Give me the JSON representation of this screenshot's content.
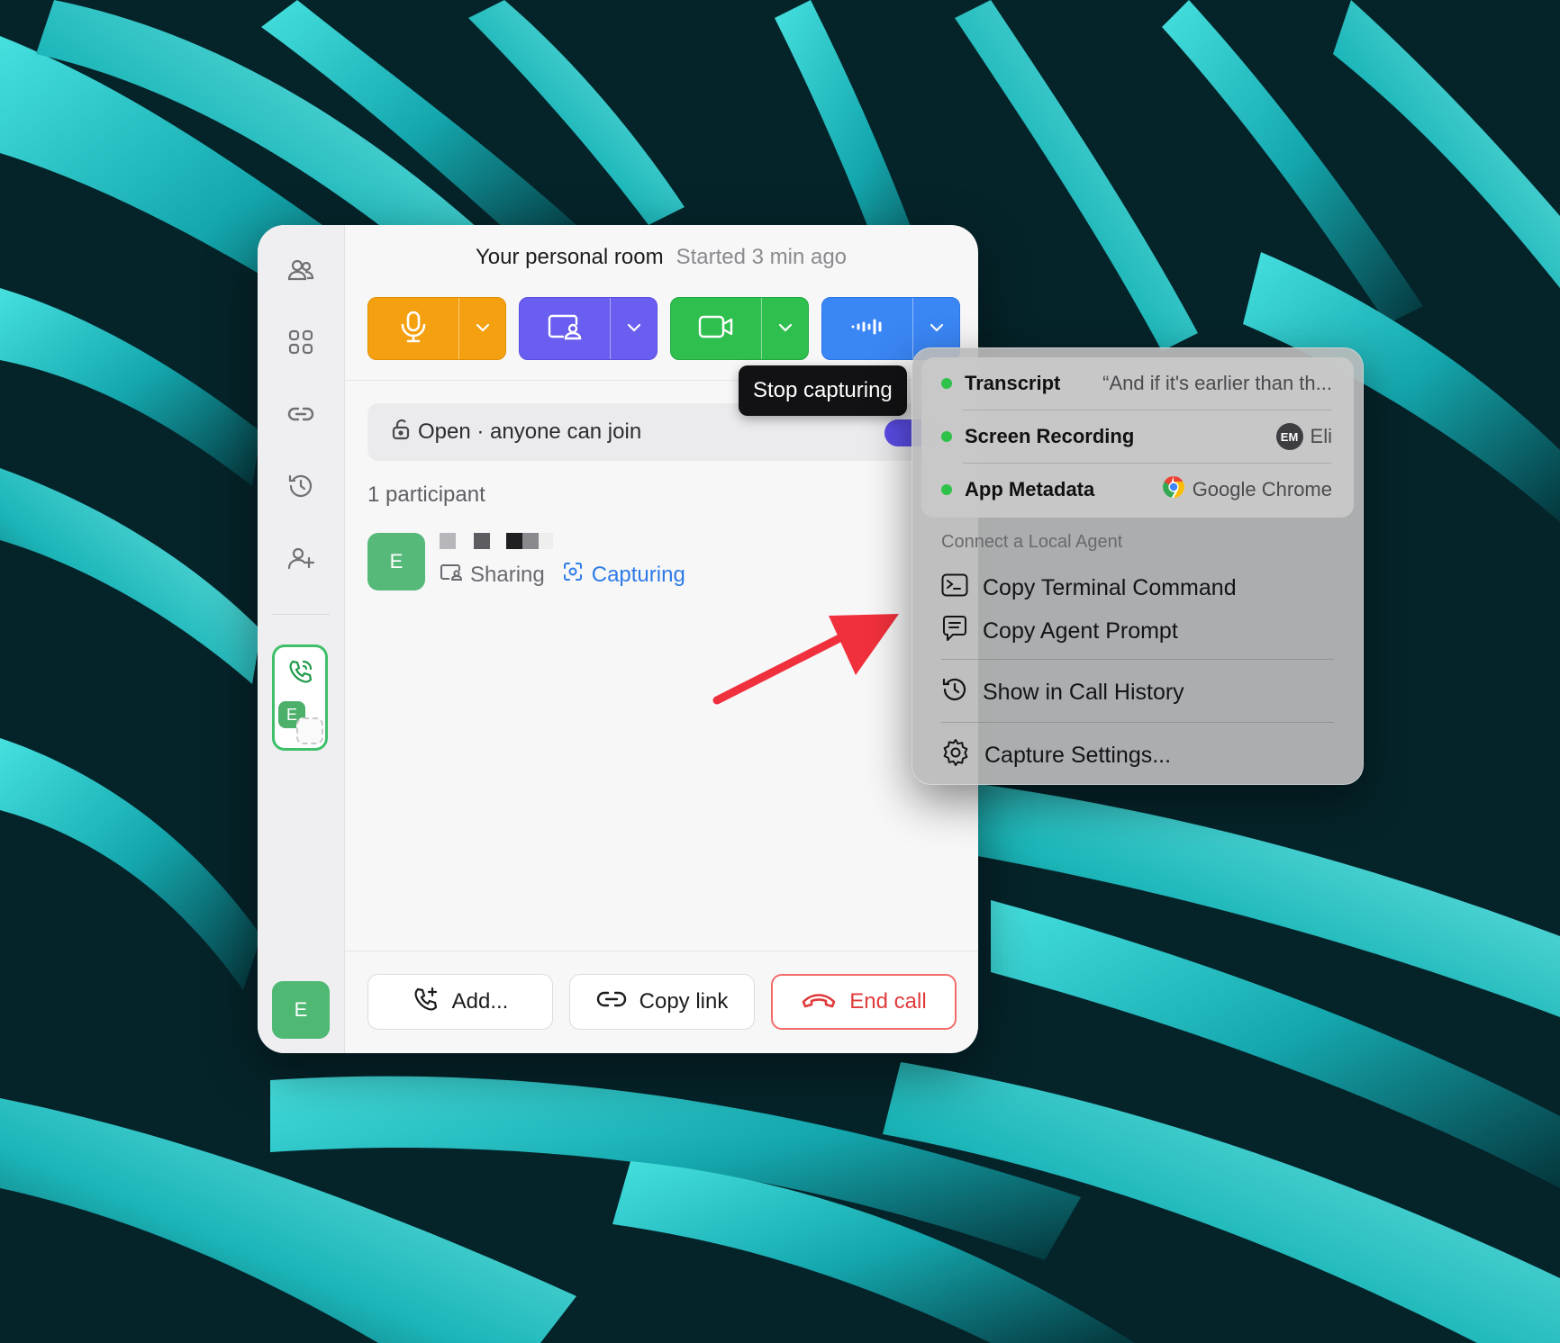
{
  "header": {
    "room_title": "Your personal room",
    "started": "Started 3 min ago"
  },
  "controls": {
    "mic": {
      "icon": "microphone-icon",
      "color": "#f5a011"
    },
    "share": {
      "icon": "screen-share-icon",
      "color": "#6a5ef0"
    },
    "camera": {
      "icon": "video-camera-icon",
      "color": "#2fbf4f"
    },
    "capture": {
      "icon": "audio-waveform-icon",
      "color": "#3a86f5"
    }
  },
  "tooltip": "Stop capturing",
  "access": {
    "label": "Open · anyone can join",
    "toggle_on": true
  },
  "participants": {
    "count_label": "1 participant",
    "items": [
      {
        "initial": "E",
        "sharing_label": "Sharing",
        "capturing_label": "Capturing"
      }
    ]
  },
  "rail": {
    "items": [
      "people-icon",
      "apps-grid-icon",
      "link-icon",
      "history-icon",
      "add-person-icon"
    ],
    "live_call_avatar": "E",
    "user_avatar": "E"
  },
  "footer": {
    "add_label": "Add...",
    "copy_link_label": "Copy link",
    "end_call_label": "End call"
  },
  "capture_menu": {
    "status_rows": [
      {
        "label": "Transcript",
        "value": "“And if it's earlier than th..."
      },
      {
        "label": "Screen Recording",
        "badge": "EM",
        "value": "Eli"
      },
      {
        "label": "App Metadata",
        "value": "Google Chrome"
      }
    ],
    "section_title": "Connect a Local Agent",
    "items": [
      {
        "label": "Copy Terminal Command",
        "icon": "terminal-icon"
      },
      {
        "label": "Copy Agent Prompt",
        "icon": "chat-bubble-icon"
      },
      {
        "label": "Show in Call History",
        "icon": "history-icon"
      },
      {
        "label": "Capture Settings...",
        "icon": "gear-icon"
      }
    ]
  },
  "colors": {
    "accent_green": "#2fc24a",
    "end_call_red": "#e03a3a",
    "capturing_blue": "#2d7be6",
    "arrow_red": "#f0303c"
  }
}
